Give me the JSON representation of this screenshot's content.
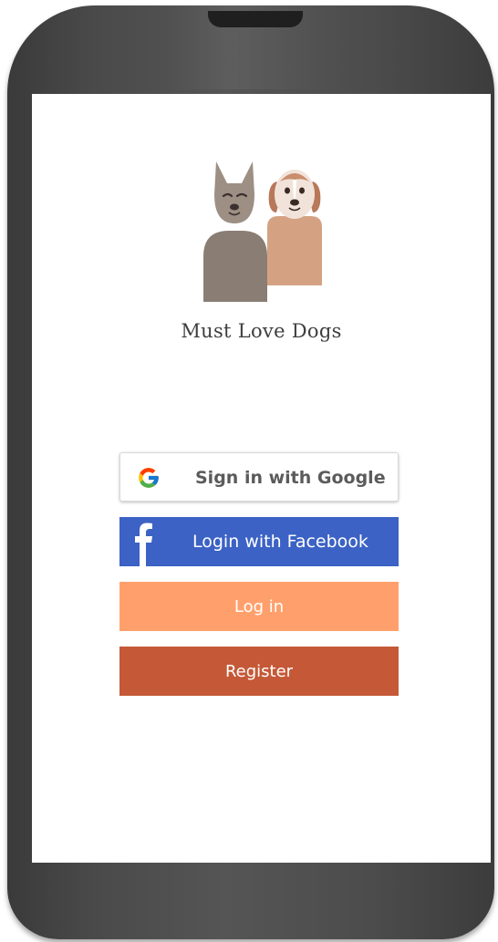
{
  "app": {
    "name": "Must Love Dogs"
  },
  "auth": {
    "google_label": "Sign in with Google",
    "facebook_label": "Login with Facebook",
    "login_label": "Log in",
    "register_label": "Register"
  },
  "icons": {
    "logo": "two-dogs-logo-icon",
    "google": "google-g-icon",
    "facebook": "facebook-f-icon"
  },
  "colors": {
    "facebook": "#3b62c4",
    "login": "#ffa06c",
    "register": "#c55937",
    "phone_frame": "#4a4a4a",
    "dog_gray": "#8a7d74",
    "dog_tan": "#d4a283"
  }
}
